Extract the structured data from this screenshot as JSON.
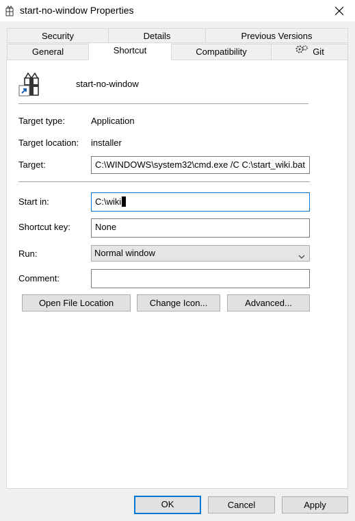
{
  "window": {
    "title": "start-no-window Properties"
  },
  "tabs_row1": [
    {
      "label": "Security"
    },
    {
      "label": "Details"
    },
    {
      "label": "Previous Versions"
    }
  ],
  "tabs_row2": [
    {
      "label": "General"
    },
    {
      "label": "Shortcut"
    },
    {
      "label": "Compatibility"
    },
    {
      "label": "Git"
    }
  ],
  "active_tab": "Shortcut",
  "shortcut": {
    "name": "start-no-window",
    "target_type_label": "Target type:",
    "target_type_value": "Application",
    "target_location_label": "Target location:",
    "target_location_value": "installer",
    "target_label": "Target:",
    "target_value": "C:\\WINDOWS\\system32\\cmd.exe /C C:\\start_wiki.bat",
    "start_in_label": "Start in:",
    "start_in_value": "C:\\wiki",
    "shortcut_key_label": "Shortcut key:",
    "shortcut_key_value": "None",
    "run_label": "Run:",
    "run_value": "Normal window",
    "comment_label": "Comment:",
    "comment_value": "",
    "open_file_location": "Open File Location",
    "change_icon": "Change Icon...",
    "advanced": "Advanced..."
  },
  "footer": {
    "ok": "OK",
    "cancel": "Cancel",
    "apply": "Apply"
  },
  "colors": {
    "accent": "#0078d7",
    "background": "#f0f0f0",
    "panel": "#ffffff"
  }
}
